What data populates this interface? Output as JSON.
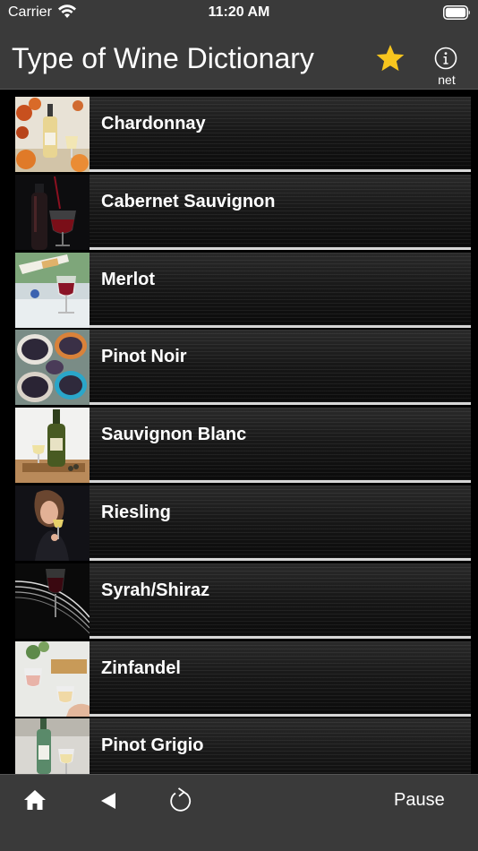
{
  "status_bar": {
    "carrier": "Carrier",
    "time": "11:20 AM"
  },
  "nav": {
    "title": "Type of Wine Dictionary",
    "favorites_icon": "star-icon",
    "info_icon": "info-icon",
    "info_label": "net",
    "star_color": "#f7c51e"
  },
  "wines": [
    {
      "label": "Chardonnay",
      "thumbnail": "white wine bottle with autumn leaves and pumpkins"
    },
    {
      "label": "Cabernet Sauvignon",
      "thumbnail": "red wine pouring into glass on dark background"
    },
    {
      "label": "Merlot",
      "thumbnail": "glass of red wine with bottle on table"
    },
    {
      "label": "Pinot Noir",
      "thumbnail": "bowls of dark grapes"
    },
    {
      "label": "Sauvignon Blanc",
      "thumbnail": "green bottle and glass on wooden board"
    },
    {
      "label": "Riesling",
      "thumbnail": "woman sipping wine in dark"
    },
    {
      "label": "Syrah/Shiraz",
      "thumbnail": "wine glass with light streaks"
    },
    {
      "label": "Zinfandel",
      "thumbnail": "rose wine glasses on table"
    },
    {
      "label": "Pinot Grigio",
      "thumbnail": "white wine bottle and glass"
    }
  ],
  "toolbar": {
    "home_icon": "home-icon",
    "back_icon": "back-icon",
    "refresh_icon": "refresh-icon",
    "pause_label": "Pause"
  },
  "colors": {
    "bar_background": "#3a3a3a",
    "row_separator": "#d7d7d7",
    "text": "#ffffff"
  }
}
